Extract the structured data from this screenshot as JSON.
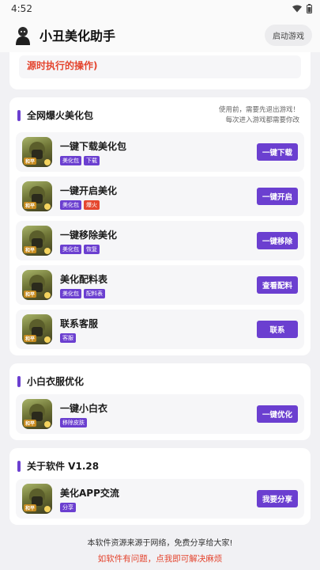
{
  "status": {
    "time": "4:52",
    "wifi_icon": "wifi-icon",
    "battery_icon": "battery-icon"
  },
  "app_bar": {
    "title": "小丑美化助手",
    "launch_label": "启动游戏",
    "logo_icon": "joker-logo-icon"
  },
  "top_card": {
    "text": "源时执行的操作)"
  },
  "sections": [
    {
      "title": "全网爆火美化包",
      "note_line1": "使用前，需要先退出游戏！",
      "note_line2": "每次进入游戏都需要你改",
      "items": [
        {
          "title": "一键下载美化包",
          "badges": [
            "美化包",
            "下载"
          ],
          "action": "一键下载"
        },
        {
          "title": "一键开启美化",
          "badges": [
            "美化包",
            "爆火"
          ],
          "action": "一键开启"
        },
        {
          "title": "一键移除美化",
          "badges": [
            "美化包",
            "恢复"
          ],
          "action": "一键移除"
        },
        {
          "title": "美化配料表",
          "badges": [
            "美化包",
            "配料表"
          ],
          "action": "查看配料"
        },
        {
          "title": "联系客服",
          "badges": [
            "客服"
          ],
          "action": "联系"
        }
      ]
    },
    {
      "title": "小白衣服优化",
      "items": [
        {
          "title": "一键小白衣",
          "badges": [
            "移除皮肤"
          ],
          "action": "一键优化"
        }
      ]
    },
    {
      "title": "关于软件 V1.28",
      "items": [
        {
          "title": "美化APP交流",
          "badges": [
            "分享"
          ],
          "action": "我要分享"
        }
      ]
    }
  ],
  "icon_tag": "和平",
  "footer": {
    "line1": "本软件资源来源于网络，免费分享给大家!",
    "line2": "如软件有问题，点我即可解决麻烦"
  },
  "colors": {
    "accent": "#6b3fd0",
    "warning": "#e4452f",
    "background": "#f1f1f4"
  }
}
